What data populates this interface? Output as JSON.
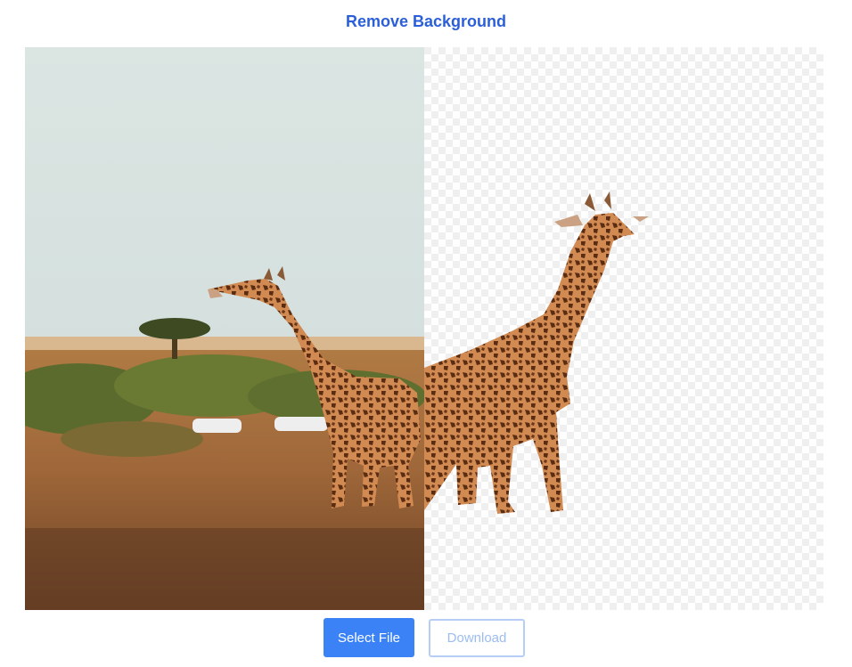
{
  "app": {
    "title": "Remove Background"
  },
  "preview": {
    "original_label": "original-photo",
    "result_label": "background-removed-result"
  },
  "actions": {
    "select_file_label": "Select File",
    "download_label": "Download",
    "download_enabled": false
  },
  "colors": {
    "accent": "#3b82f6",
    "title": "#2b5fd9",
    "download_text": "#9cbcf2"
  }
}
